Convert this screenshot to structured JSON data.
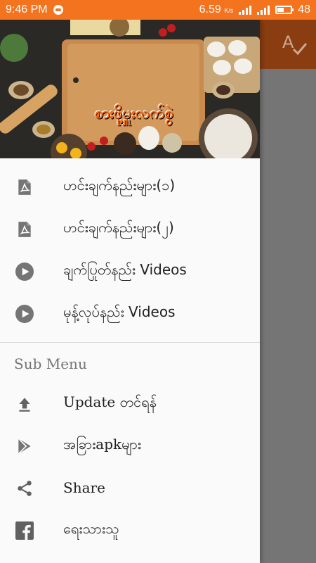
{
  "status_bar": {
    "time": "9:46 PM",
    "speed": "6.59",
    "speed_unit": "K/s",
    "battery": "48"
  },
  "drawer": {
    "header_title": "စားဖို့မှူးလက်စွဲ",
    "items": [
      {
        "label": "ဟင်းချက်နည်းများ(၁)",
        "icon": "pdf-icon"
      },
      {
        "label": "ဟင်းချက်နည်းများ(၂)",
        "icon": "pdf-icon"
      },
      {
        "label": "ချက်ပြုတ်နည်း Videos",
        "icon": "play-icon"
      },
      {
        "label": "မုန့်လုပ်နည်း Videos",
        "icon": "play-icon"
      }
    ],
    "section_label": "Sub Menu",
    "sub_items": [
      {
        "label": "Update တင်ရန်",
        "icon": "upload-icon"
      },
      {
        "label": "အခြားapkများ",
        "icon": "play-store-icon"
      },
      {
        "label": "Share",
        "icon": "share-icon"
      },
      {
        "label": "ရေးသားသူ",
        "icon": "facebook-icon"
      }
    ]
  },
  "colors": {
    "status_bar": "#f4731f",
    "app_bar": "#8a3d10",
    "drawer_bg": "#fafafa",
    "icon": "#757575",
    "title_accent": "#f26a1b"
  }
}
